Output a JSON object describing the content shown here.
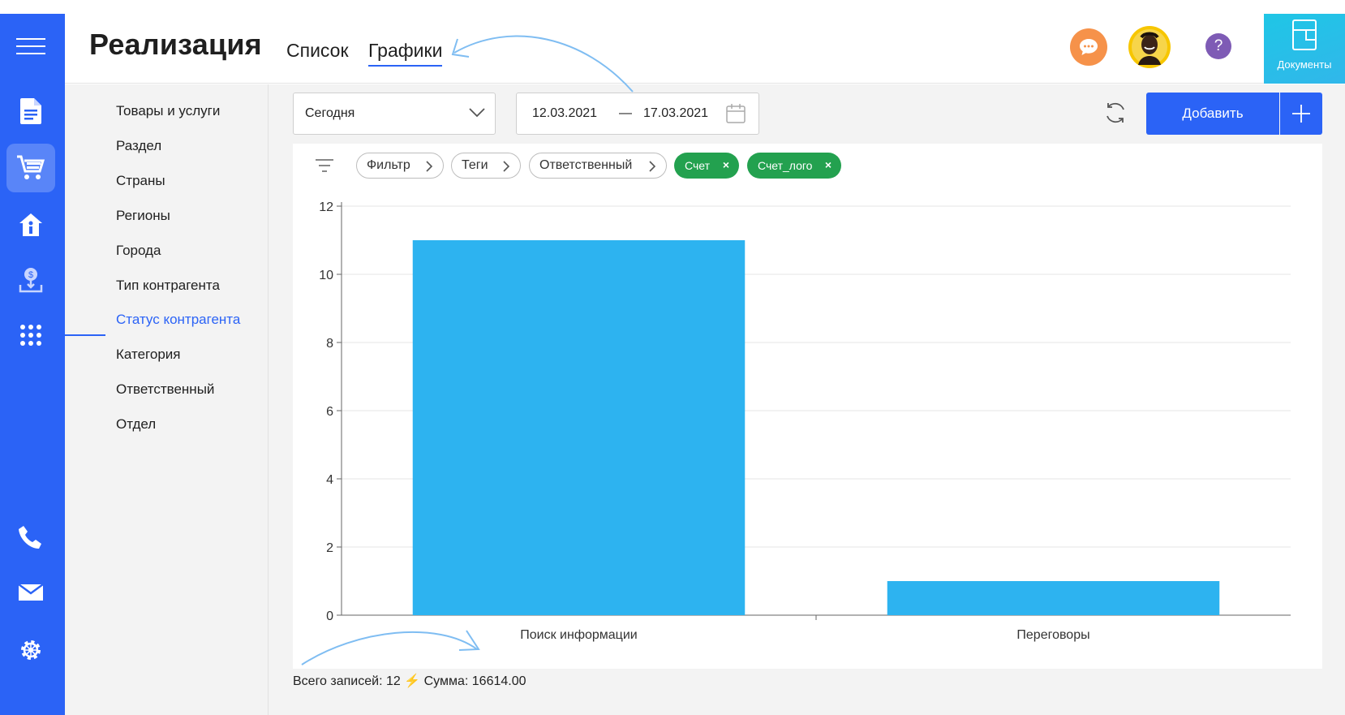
{
  "header": {
    "title": "Реализация",
    "tabs": [
      {
        "label": "Список",
        "active": false
      },
      {
        "label": "Графики",
        "active": true
      }
    ],
    "docs_label": "Документы",
    "help_symbol": "?"
  },
  "rail": {
    "items": [
      {
        "icon": "document-icon",
        "active": false
      },
      {
        "icon": "cart-icon",
        "active": true
      },
      {
        "icon": "house-info-icon",
        "active": false
      },
      {
        "icon": "dollar-download-icon",
        "active": false
      },
      {
        "icon": "apps-grid-icon",
        "active": false
      },
      {
        "icon": "phone-icon",
        "active": false
      },
      {
        "icon": "mail-icon",
        "active": false
      },
      {
        "icon": "gear-icon",
        "active": false
      }
    ]
  },
  "subnav": {
    "items": [
      {
        "label": "Товары и услуги",
        "active": false
      },
      {
        "label": "Раздел",
        "active": false
      },
      {
        "label": "Страны",
        "active": false
      },
      {
        "label": "Регионы",
        "active": false
      },
      {
        "label": "Города",
        "active": false
      },
      {
        "label": "Тип контрагента",
        "active": false
      },
      {
        "label": "Статус контрагента",
        "active": true
      },
      {
        "label": "Категория",
        "active": false
      },
      {
        "label": "Ответственный",
        "active": false
      },
      {
        "label": "Отдел",
        "active": false
      }
    ]
  },
  "toolbar": {
    "period_value": "Сегодня",
    "date_from": "12.03.2021",
    "date_separator": "—",
    "date_to": "17.03.2021",
    "add_label": "Добавить"
  },
  "filters": {
    "chips": [
      "Фильтр",
      "Теги",
      "Ответственный"
    ],
    "active_tags": [
      "Счет",
      "Счет_лого"
    ],
    "remove_symbol": "×"
  },
  "colors": {
    "accent": "#2b63f6",
    "bar": "#2db3f0",
    "tag_green": "#23a14f",
    "chat_orange": "#f6924a",
    "help_purple": "#7e5bb5"
  },
  "chart_data": {
    "type": "bar",
    "categories": [
      "Поиск информации",
      "Переговоры"
    ],
    "values": [
      11,
      1
    ],
    "title": "",
    "xlabel": "",
    "ylabel": "",
    "ylim": [
      0,
      12
    ],
    "yticks": [
      0,
      2,
      4,
      6,
      8,
      10,
      12
    ],
    "grid": true
  },
  "summary": {
    "records_label": "Всего записей:",
    "records_value": "12",
    "bolt": "⚡",
    "sum_label": "Сумма:",
    "sum_value": "16614.00"
  }
}
